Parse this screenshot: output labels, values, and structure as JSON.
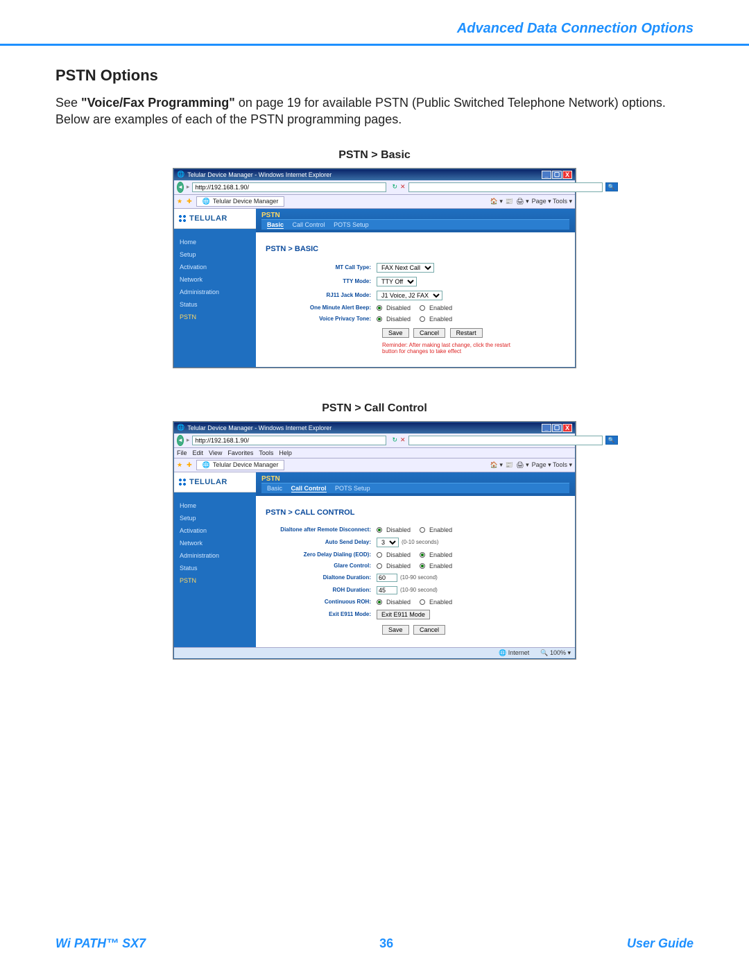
{
  "header": {
    "title": "Advanced Data Connection Options"
  },
  "section": {
    "title": "PSTN Options",
    "body_prefix": "See ",
    "body_bold": "\"Voice/Fax Programming\"",
    "body_rest": " on page 19 for available PSTN (Public Switched Telephone Network) options. Below are examples of each of the PSTN programming pages."
  },
  "figures": {
    "basic": {
      "caption": "PSTN > Basic",
      "window_title": "Telular Device Manager - Windows Internet Explorer",
      "address": "http://192.168.1.90/",
      "tab_label": "Telular Device Manager",
      "toolbar_right": "Page ▾  Tools ▾",
      "brand": "TELULAR",
      "nav": [
        "Home",
        "Setup",
        "Activation",
        "Network",
        "Administration",
        "Status",
        "PSTN"
      ],
      "nav_active": "PSTN",
      "pstn_header": "PSTN",
      "pstn_tabs": [
        "Basic",
        "Call Control",
        "POTS Setup"
      ],
      "pstn_tab_active": "Basic",
      "content_title": "PSTN > BASIC",
      "fields": {
        "mt_call_type": {
          "label": "MT Call Type:",
          "value": "FAX Next Call"
        },
        "tty_mode": {
          "label": "TTY Mode:",
          "value": "TTY Off"
        },
        "rj11_jack": {
          "label": "RJ11 Jack Mode:",
          "value": "J1 Voice, J2 FAX"
        },
        "one_min_beep": {
          "label": "One Minute Alert Beep:",
          "disabled": "Disabled",
          "enabled": "Enabled",
          "selected": "disabled"
        },
        "voice_privacy": {
          "label": "Voice Privacy Tone:",
          "disabled": "Disabled",
          "enabled": "Enabled",
          "selected": "disabled"
        }
      },
      "buttons": {
        "save": "Save",
        "cancel": "Cancel",
        "restart": "Restart"
      },
      "reminder": "Reminder: After making last change, click the restart button for changes to take effect"
    },
    "callcontrol": {
      "caption": "PSTN > Call Control",
      "window_title": "Telular Device Manager - Windows Internet Explorer",
      "address": "http://192.168.1.90/",
      "menubar": [
        "File",
        "Edit",
        "View",
        "Favorites",
        "Tools",
        "Help"
      ],
      "tab_label": "Telular Device Manager",
      "toolbar_right": "Page ▾  Tools ▾",
      "brand": "TELULAR",
      "nav": [
        "Home",
        "Setup",
        "Activation",
        "Network",
        "Administration",
        "Status",
        "PSTN"
      ],
      "nav_active": "PSTN",
      "pstn_header": "PSTN",
      "pstn_tabs": [
        "Basic",
        "Call Control",
        "POTS Setup"
      ],
      "pstn_tab_active": "Call Control",
      "content_title": "PSTN > CALL CONTROL",
      "fields": {
        "dialtone_remote": {
          "label": "Dialtone after Remote Disconnect:",
          "disabled": "Disabled",
          "enabled": "Enabled",
          "selected": "disabled"
        },
        "auto_send_delay": {
          "label": "Auto Send Delay:",
          "value": "3",
          "hint": "(0-10 seconds)"
        },
        "zero_delay": {
          "label": "Zero Delay Dialing (EOD):",
          "disabled": "Disabled",
          "enabled": "Enabled",
          "selected": "enabled"
        },
        "glare": {
          "label": "Glare Control:",
          "disabled": "Disabled",
          "enabled": "Enabled",
          "selected": "enabled"
        },
        "dialtone_dur": {
          "label": "Dialtone Duration:",
          "value": "60",
          "hint": "(10-90 second)"
        },
        "roh_dur": {
          "label": "ROH Duration:",
          "value": "45",
          "hint": "(10-90 second)"
        },
        "cont_roh": {
          "label": "Continuous ROH:",
          "disabled": "Disabled",
          "enabled": "Enabled",
          "selected": "disabled"
        },
        "exit_e911": {
          "label": "Exit E911 Mode:",
          "button": "Exit E911 Mode"
        }
      },
      "buttons": {
        "save": "Save",
        "cancel": "Cancel"
      },
      "status": {
        "zone": "Internet",
        "zoom": "100%"
      }
    }
  },
  "footer": {
    "product": "Wi PATH™ SX7",
    "page": "36",
    "guide": "User Guide"
  }
}
